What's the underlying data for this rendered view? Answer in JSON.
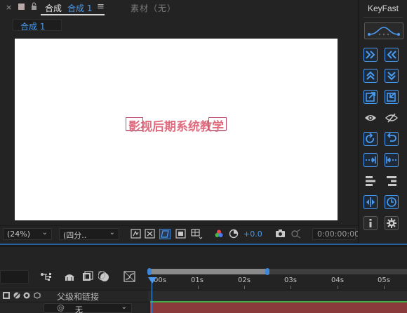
{
  "composition_panel": {
    "tab": {
      "close_icon": "×",
      "title_prefix": "合成",
      "title_name": "合成 1",
      "menu_icon": "≡"
    },
    "footage_tab": "素材（无）",
    "sub_tab": "合成 1",
    "canvas_text": "影视后期系统教学",
    "toolbar": {
      "zoom": "(24%)",
      "resolution": "(四分..",
      "exposure": "+0.0",
      "timecode": "0:00:00:00"
    }
  },
  "keyfast_panel": {
    "title": "KeyFast",
    "buttons": [
      "ease-right-icon",
      "ease-left-icon",
      "ease-up-icon",
      "ease-down-icon",
      "export-in-icon",
      "export-out-icon",
      "eye-icon",
      "eye-hidden-icon",
      "rotate-cw-icon",
      "rotate-ccw-icon",
      "arrow-right-dashed-icon",
      "arrow-left-dashed-icon",
      "align-left-icon",
      "align-right-icon",
      "mirror-icon",
      "clock-icon",
      "info-icon",
      "gear-icon"
    ]
  },
  "timeline": {
    "ruler_labels": [
      "00s",
      "01s",
      "02s",
      "03s",
      "04s",
      "05s"
    ],
    "header_label": "父级和链接",
    "layer_parent": "无"
  },
  "colors": {
    "accent": "#4b9cf0",
    "panel_bg": "#232323",
    "canvas_text": "#e06c7f",
    "layer_bar": "#8a3a3a",
    "layer_bar_top": "#3fb142"
  }
}
